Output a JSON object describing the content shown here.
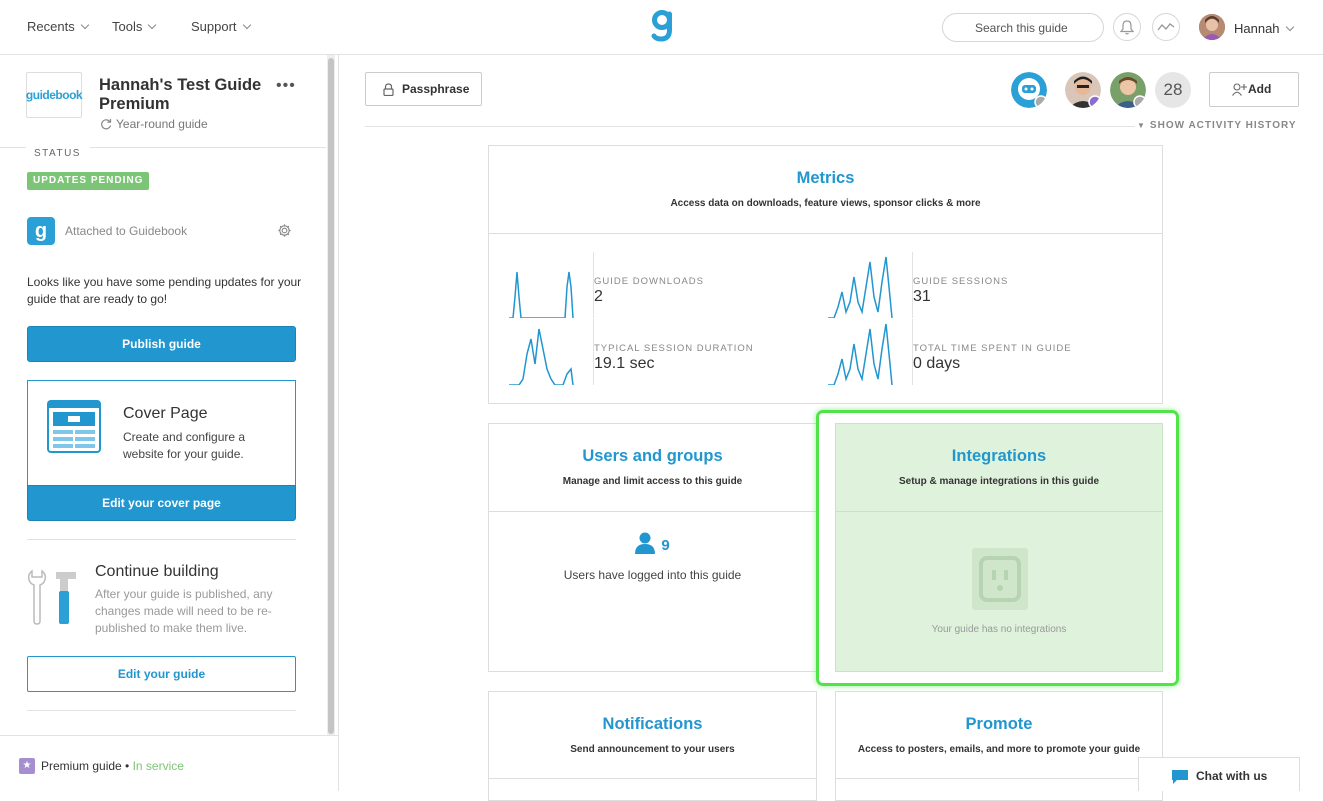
{
  "topbar": {
    "nav": [
      "Recents",
      "Tools",
      "Support"
    ],
    "search_placeholder": "Search this guide",
    "user_name": "Hannah",
    "brand_color": "#2aa0d6"
  },
  "sidebar": {
    "logo_text": "guidebook",
    "guide_title": "Hannah's Test Guide Premium",
    "guide_type": "Year-round guide",
    "status_label": "STATUS",
    "status_badge": "UPDATES PENDING",
    "attached_text": "Attached to Guidebook",
    "pending_text": "Looks like you have some pending updates for your guide that are ready to go!",
    "publish_label": "Publish guide",
    "cover_title": "Cover Page",
    "cover_desc": "Create and configure a website for your guide.",
    "cover_button": "Edit your cover page",
    "continue_title": "Continue building",
    "continue_desc": "After your guide is published, any changes made will need to be re-published to make them live.",
    "edit_button": "Edit your guide",
    "footer_plan": "Premium guide",
    "footer_sep": "•",
    "footer_status": "In service"
  },
  "main": {
    "passphrase": "Passphrase",
    "collaborator_count": "28",
    "add_label": "Add",
    "activity_history": "SHOW ACTIVITY HISTORY",
    "metrics": {
      "title": "Metrics",
      "subtitle": "Access data on downloads, feature views, sponsor clicks & more",
      "items": [
        {
          "label": "GUIDE DOWNLOADS",
          "value": "2"
        },
        {
          "label": "GUIDE SESSIONS",
          "value": "31"
        },
        {
          "label": "TYPICAL SESSION DURATION",
          "value": "19.1 sec"
        },
        {
          "label": "TOTAL TIME SPENT IN GUIDE",
          "value": "0 days"
        }
      ]
    },
    "users": {
      "title": "Users and groups",
      "subtitle": "Manage and limit access to this guide",
      "count": "9",
      "count_text": "Users have logged into this guide"
    },
    "integrations": {
      "title": "Integrations",
      "subtitle": "Setup & manage integrations in this guide",
      "empty_text": "Your guide has no integrations",
      "highlight_color": "#51e34a"
    },
    "notifications": {
      "title": "Notifications",
      "subtitle": "Send announcement to your users"
    },
    "promote": {
      "title": "Promote",
      "subtitle": "Access to posters, emails, and more to promote your guide"
    },
    "chat_label": "Chat with us"
  }
}
